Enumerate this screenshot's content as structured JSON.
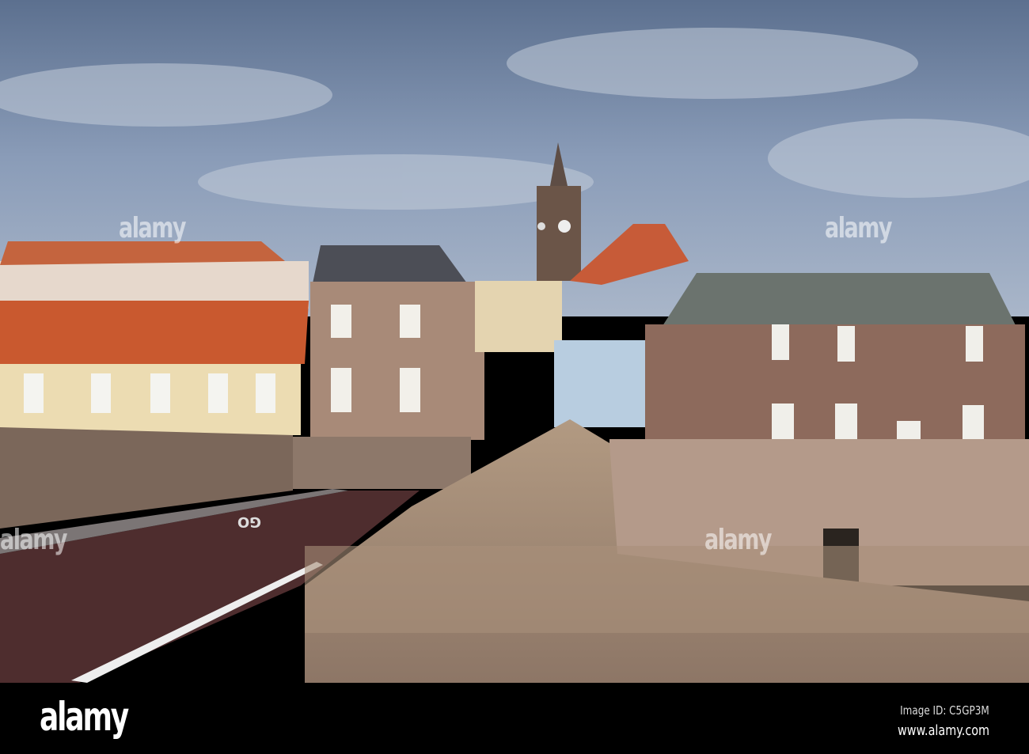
{
  "watermark": {
    "text": "alamy"
  },
  "footer": {
    "logo": "alamy",
    "image_id": "Image ID: C5GP3M",
    "url": "www.alamy.com"
  },
  "road_marking": "GO",
  "colors": {
    "sky": "#6f85a6",
    "roof": "#c95a33",
    "stone": "#9c8070",
    "road": "#4a2a2a"
  }
}
